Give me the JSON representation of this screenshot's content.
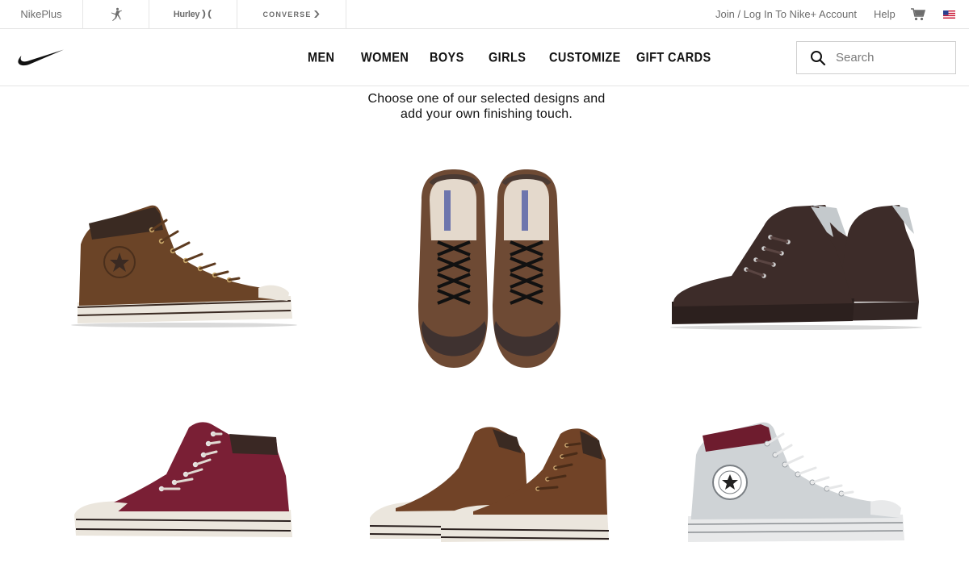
{
  "top_bar": {
    "brands": [
      {
        "label": "NikePlus",
        "icon": "nikeplus-link"
      },
      {
        "label": "",
        "icon": "jordan-jumpman-icon"
      },
      {
        "label": "Hurley",
        "icon": "hurley-logo"
      },
      {
        "label": "CONVERSE",
        "icon": "converse-logo"
      }
    ],
    "login_label": "Join / Log In To Nike+ Account",
    "help_label": "Help",
    "cart_icon": "shopping-cart-icon",
    "locale_icon": "us-flag-icon"
  },
  "main_nav": {
    "logo": "nike-swoosh-logo",
    "links": [
      "MEN",
      "WOMEN",
      "BOYS",
      "GIRLS",
      "CUSTOMIZE",
      "GIFT CARDS"
    ],
    "search": {
      "placeholder": "Search",
      "value": "",
      "icon": "search-icon"
    }
  },
  "intro": {
    "line1": "Choose one of our selected designs and",
    "line2": "add your own finishing touch."
  },
  "products": [
    {
      "name": "brown high-top sneaker side view",
      "upper": "#6b4427",
      "collar": "#3a2a22"
    },
    {
      "name": "brown high-top pair top view",
      "upper": "#6e4a34",
      "collar": "#4a3a33"
    },
    {
      "name": "dark brown high-top pair",
      "upper": "#3d2c29",
      "collar": "#c4c9cc"
    },
    {
      "name": "burgundy high-top sneaker",
      "upper": "#7a1f35",
      "collar": "#3a2824"
    },
    {
      "name": "brown high-top pair",
      "upper": "#714327",
      "collar": "#3a2a22"
    },
    {
      "name": "light grey high-top sneaker",
      "upper": "#cfd3d6",
      "collar": "#6e1c2e"
    }
  ],
  "colors": {
    "nav_text": "#111111",
    "muted_text": "#6d6d6d",
    "border": "#e5e5e5"
  }
}
